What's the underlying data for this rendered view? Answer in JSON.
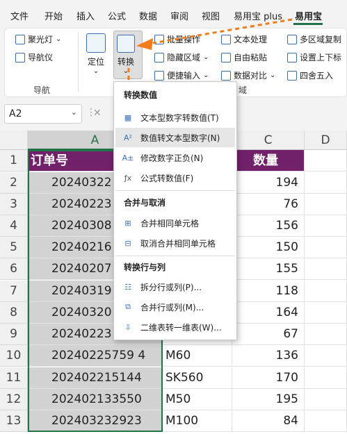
{
  "menubar": {
    "tabs": [
      {
        "label": "文件"
      },
      {
        "label": "开始"
      },
      {
        "label": "插入"
      },
      {
        "label": "公式"
      },
      {
        "label": "数据"
      },
      {
        "label": "审阅"
      },
      {
        "label": "视图"
      },
      {
        "label": "易用宝 plus"
      },
      {
        "label": "易用宝",
        "active": true
      }
    ]
  },
  "ribbon": {
    "nav_group_label": "导航",
    "spotlight": "聚光灯",
    "navigator": "导航仪",
    "locate": "定位",
    "convert": "转换",
    "batch_ops": "批量操作",
    "hide_area": "隐藏区域",
    "quick_input": "便捷输入",
    "text_process": "文本处理",
    "free_paste": "自由粘贴",
    "data_compare": "数据对比",
    "multi_copy": "多区域复制",
    "sub_superscript": "设置上下标",
    "round": "四舍五入",
    "partial_label": "域"
  },
  "formula_bar": {
    "name_box": "A2",
    "dd": "⌄",
    "x": "✕"
  },
  "sheet": {
    "columns": [
      "A",
      "B",
      "C",
      "D"
    ],
    "header_row": {
      "a": "订单号",
      "c": "数量"
    },
    "rows": [
      {
        "n": "1"
      },
      {
        "n": "2",
        "a": "20240322",
        "c": "194"
      },
      {
        "n": "3",
        "a": "20240223",
        "c": "76"
      },
      {
        "n": "4",
        "a": "20240308",
        "c": "156"
      },
      {
        "n": "5",
        "a": "20240216",
        "c": "150"
      },
      {
        "n": "6",
        "a": "20240207",
        "c": "155"
      },
      {
        "n": "7",
        "a": "20240319",
        "c": "118"
      },
      {
        "n": "8",
        "a": "20240320",
        "c": "164"
      },
      {
        "n": "9",
        "a": "20240223",
        "c": "67"
      },
      {
        "n": "10",
        "a": "20240225759 4",
        "b": "M60",
        "c": "136"
      },
      {
        "n": "11",
        "a": "202402215144",
        "b": "SK560",
        "c": "170"
      },
      {
        "n": "12",
        "a": "202402133550",
        "b": "M50",
        "c": "195"
      },
      {
        "n": "13",
        "a": "202403232923",
        "b": "M100",
        "c": "84"
      }
    ]
  },
  "menu": {
    "section1": "转换数值",
    "item1": "文本型数字转数值(T)",
    "item2": "数值转文本型数字(N)",
    "item3": "修改数字正负(N)",
    "item4": "公式转数值(F)",
    "section2": "合并与取消",
    "item5": "合并相同单元格",
    "item6": "取消合并相同单元格",
    "section3": "转换行与列",
    "item7": "拆分行或列(P)...",
    "item8": "合并行或列(M)...",
    "item9": "二维表转一维表(W)..."
  },
  "colors": {
    "accent": "#217346",
    "header_fill": "#70216a",
    "arrow": "#f27b1a"
  }
}
